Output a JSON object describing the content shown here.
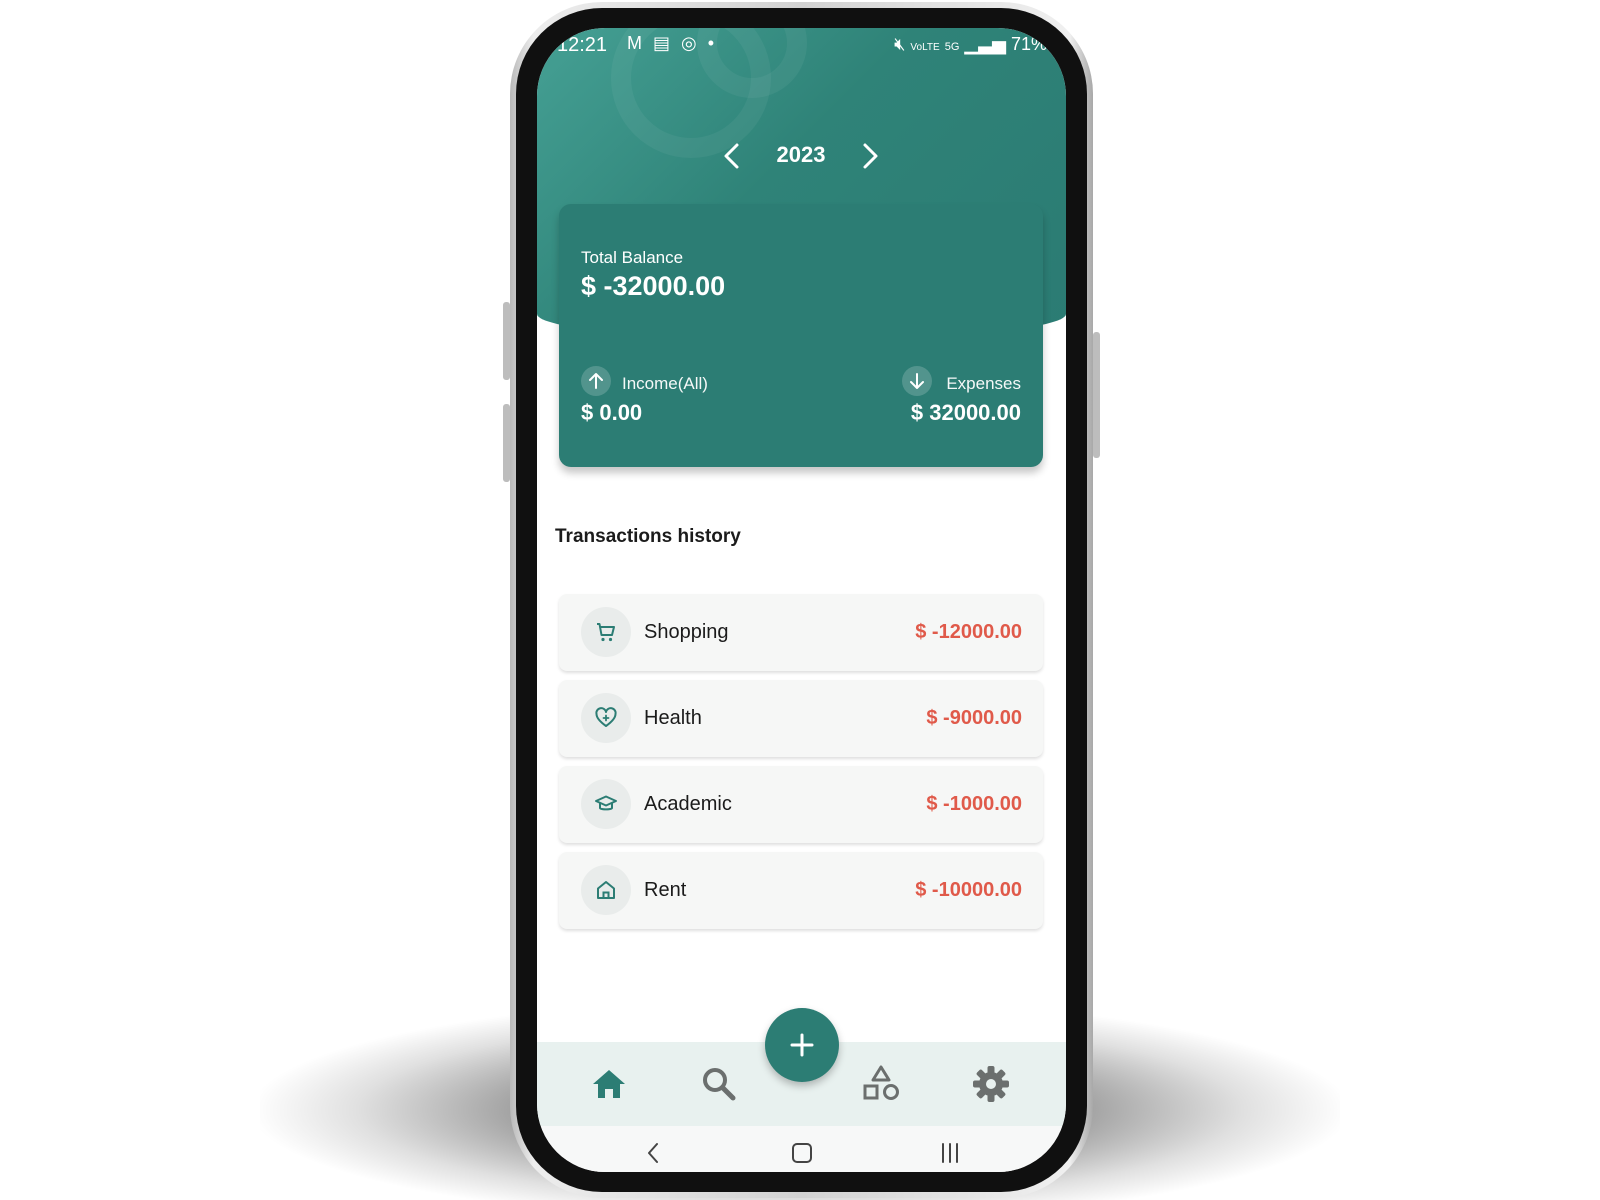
{
  "status_bar": {
    "time": "12:21",
    "battery": "71%",
    "left_icons": [
      "gmail-icon",
      "calendar-icon",
      "whatsapp-icon",
      "dot-icon"
    ],
    "right_icons": [
      "mute-icon",
      "volte-icon",
      "5g-icon",
      "signal-icon",
      "battery-icon"
    ]
  },
  "header": {
    "year": "2023",
    "prev_icon": "chevron-left-icon",
    "next_icon": "chevron-right-icon"
  },
  "balance_card": {
    "total_label": "Total Balance",
    "total_value": "$ -32000.00",
    "income_label": "Income(All)",
    "income_value": "$ 0.00",
    "expenses_label": "Expenses",
    "expenses_value": "$ 32000.00"
  },
  "transactions": {
    "title": "Transactions history",
    "items": [
      {
        "name": "Shopping",
        "amount": "$ -12000.00",
        "icon": "cart-icon"
      },
      {
        "name": "Health",
        "amount": "$ -9000.00",
        "icon": "heart-icon"
      },
      {
        "name": "Academic",
        "amount": "$ -1000.00",
        "icon": "graduation-cap-icon"
      },
      {
        "name": "Rent",
        "amount": "$ -10000.00",
        "icon": "home-icon"
      }
    ]
  },
  "bottom_nav": [
    "home-icon",
    "search-icon",
    "categories-icon",
    "settings-icon"
  ],
  "fab": {
    "icon": "plus-icon"
  },
  "colors": {
    "primary": "#2c7d74",
    "primary_light": "#45a094",
    "negative": "#e05a4a",
    "nav_bg": "#e8f1ef"
  }
}
